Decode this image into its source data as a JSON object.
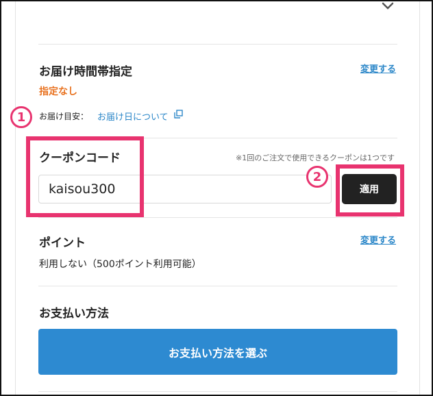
{
  "delivery_time": {
    "title": "お届け時間帯指定",
    "change_link": "変更する",
    "value": "指定なし",
    "eta_label": "お届け目安：",
    "eta_link": "お届け日について"
  },
  "coupon": {
    "title": "クーポンコード",
    "note": "※1回のご注文で使用できるクーポンは1つです",
    "input_value": "kaisou300",
    "apply_label": "適用"
  },
  "points": {
    "title": "ポイント",
    "change_link": "変更する",
    "status": "利用しない（500ポイント利用可能）"
  },
  "payment": {
    "title": "お支払い方法",
    "button_label": "お支払い方法を選ぶ"
  },
  "annotations": {
    "marker1": "1",
    "marker2": "2"
  },
  "colors": {
    "accent_link": "#2a86c8",
    "orange_status": "#e8711e",
    "pay_button": "#2d8ad1",
    "apply_button": "#222222",
    "highlight": "#e8336f"
  },
  "icons": [
    "chevron-down-icon",
    "copy-icon"
  ]
}
